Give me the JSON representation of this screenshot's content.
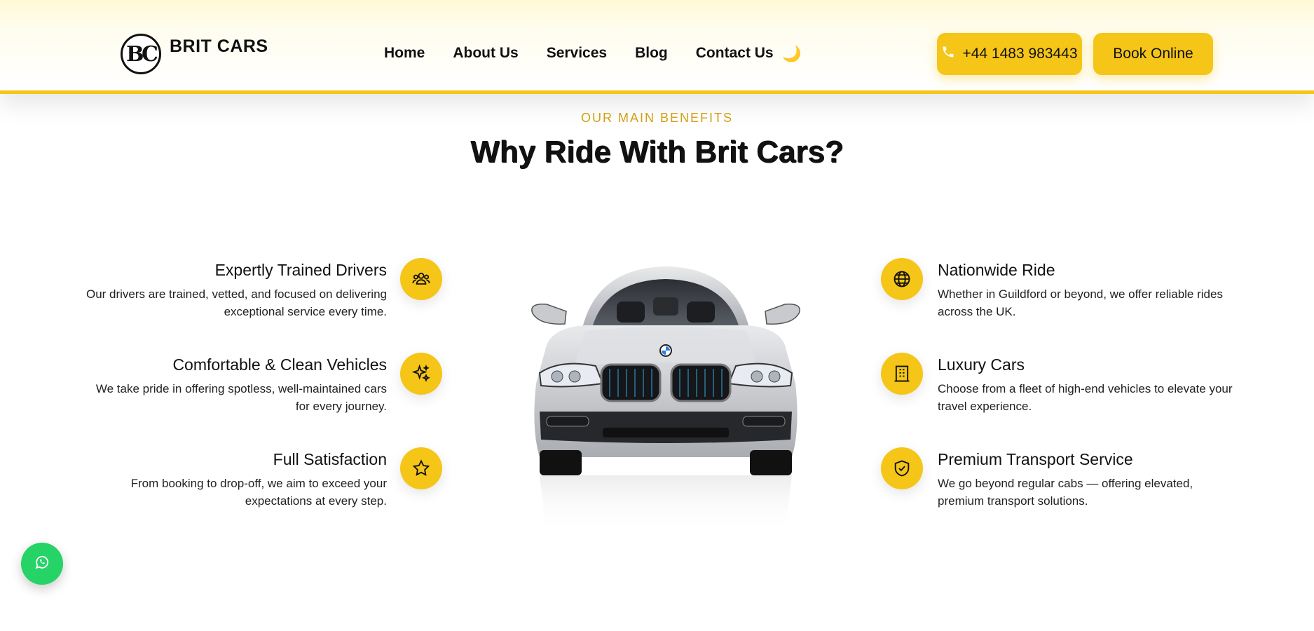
{
  "header": {
    "logo_mark": "BC",
    "logo_text": "BRIT CARS",
    "nav": [
      "Home",
      "About Us",
      "Services",
      "Blog",
      "Contact Us"
    ],
    "theme_toggle": "🌙",
    "phone_label": "+44 1483 983443",
    "book_label": "Book Online"
  },
  "section": {
    "eyebrow": "OUR MAIN BENEFITS",
    "title": "Why Ride With Brit Cars?"
  },
  "features_left": [
    {
      "title": "Expertly Trained Drivers",
      "text": "Our drivers are trained, vetted, and focused on delivering exceptional service every time.",
      "icon": "users-icon"
    },
    {
      "title": "Comfortable & Clean Vehicles",
      "text": "We take pride in offering spotless, well-maintained cars for every journey.",
      "icon": "sparkles-icon"
    },
    {
      "title": "Full Satisfaction",
      "text": "From booking to drop-off, we aim to exceed your expectations at every step.",
      "icon": "star-icon"
    }
  ],
  "features_right": [
    {
      "title": "Nationwide Ride",
      "text": "Whether in Guildford or beyond, we offer reliable rides across the UK.",
      "icon": "globe-icon"
    },
    {
      "title": "Luxury Cars",
      "text": "Choose from a fleet of high-end vehicles to elevate your travel experience.",
      "icon": "building-icon"
    },
    {
      "title": "Premium Transport Service",
      "text": "We go beyond regular cabs — offering elevated, premium transport solutions.",
      "icon": "shield-check-icon"
    }
  ],
  "colors": {
    "accent": "#f5c518",
    "eyebrow": "#d4a213",
    "whatsapp": "#25d366"
  }
}
